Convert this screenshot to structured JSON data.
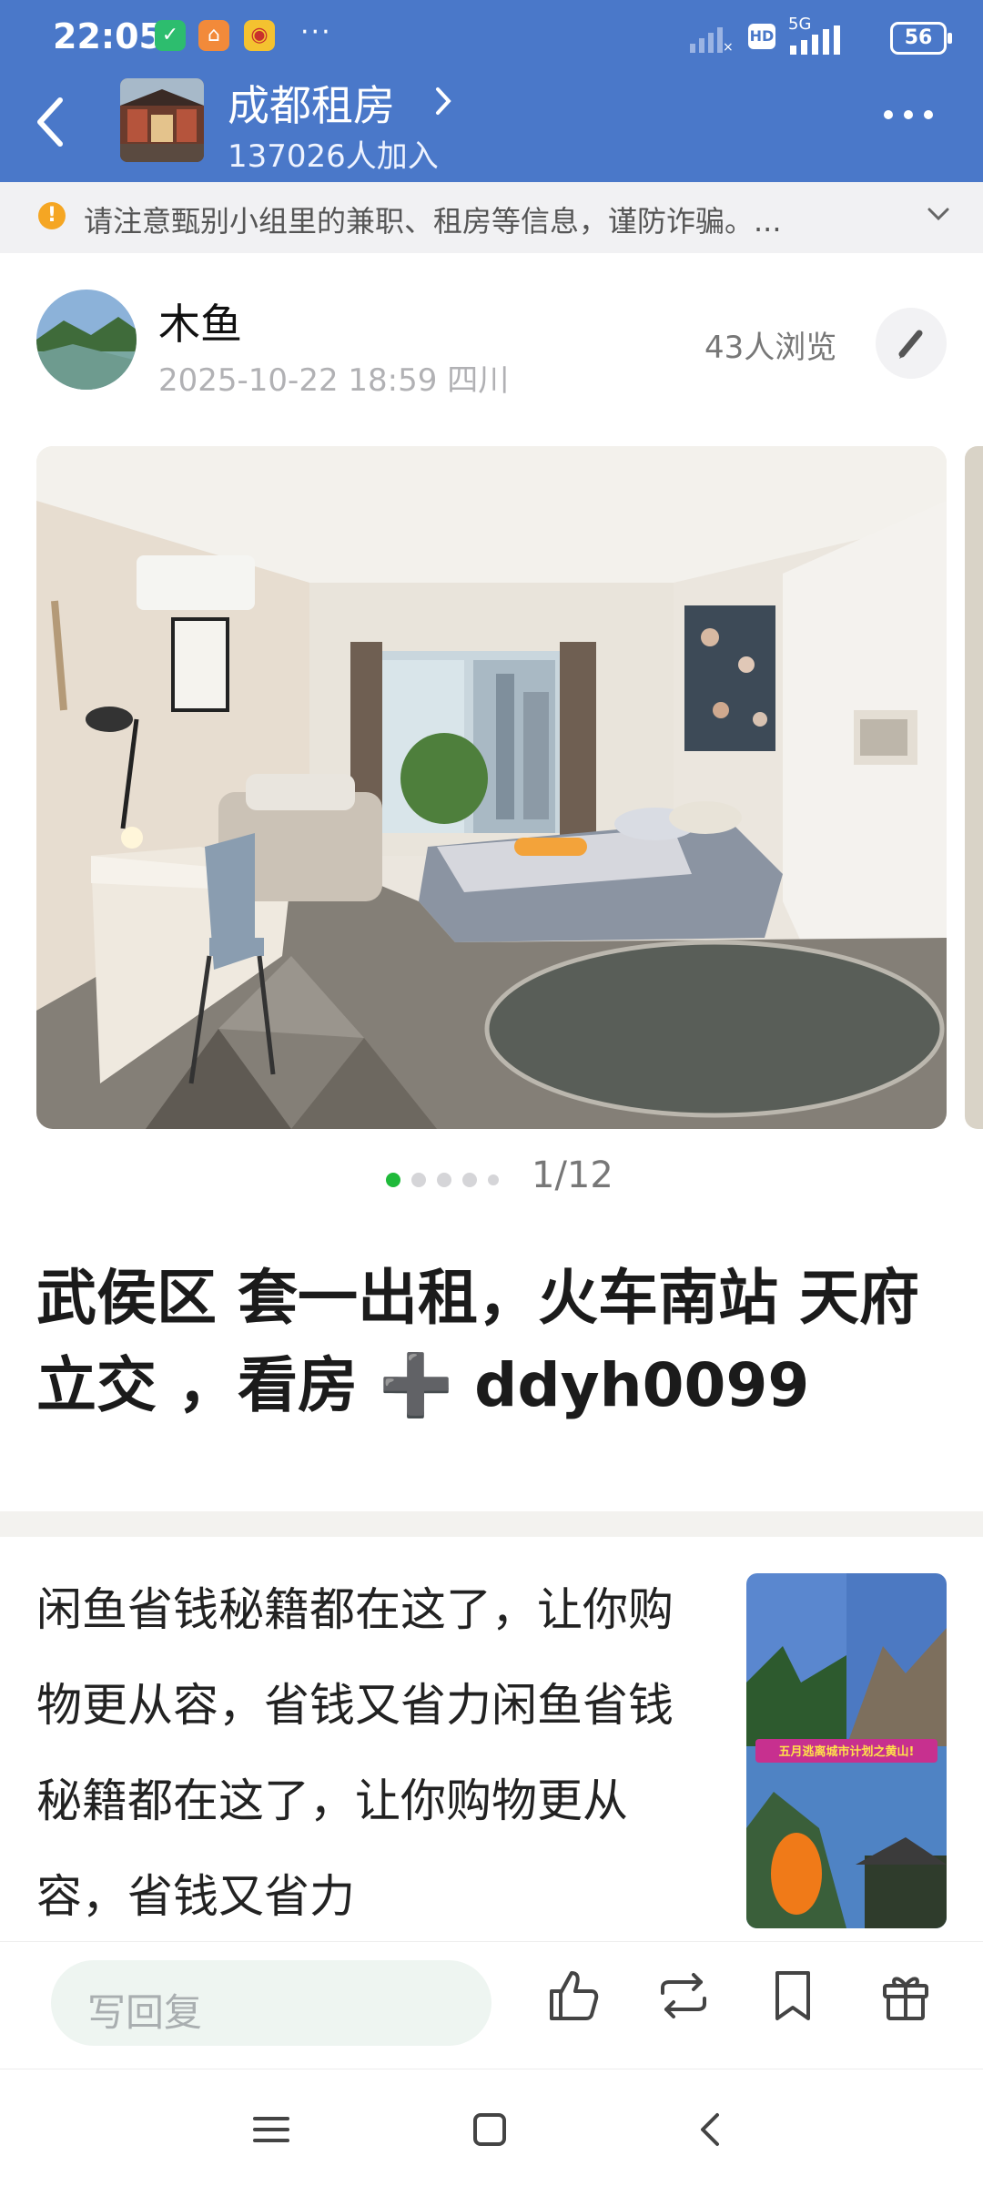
{
  "status_bar": {
    "time": "22:05",
    "dots": "···",
    "network_label": "HD",
    "network_type": "5G",
    "battery": "56"
  },
  "header": {
    "group_name": "成都租房",
    "members": "137026人加入"
  },
  "notice": {
    "text": "请注意甄别小组里的兼职、租房等信息，谨防诈骗。..."
  },
  "post": {
    "author": "木鱼",
    "datetime": "2025-10-22 18:59",
    "location": "四川",
    "views": "43人浏览",
    "photo_index": "1/12",
    "title": "武侯区 套一出租，火车南站 天府立交 ，看房 ➕ ddyh0099"
  },
  "ad": {
    "text": "闲鱼省钱秘籍都在这了，让你购物更从容，省钱又省力闲鱼省钱秘籍都在这了，让你购物更从容，省钱又省力",
    "thumb_caption": "五月逃离城市计划之黄山!"
  },
  "bottom_bar": {
    "reply_placeholder": "写回复"
  },
  "colors": {
    "header_blue": "#4a78c9",
    "page_dot_active": "#1fba3a",
    "warning": "#f5a623"
  }
}
